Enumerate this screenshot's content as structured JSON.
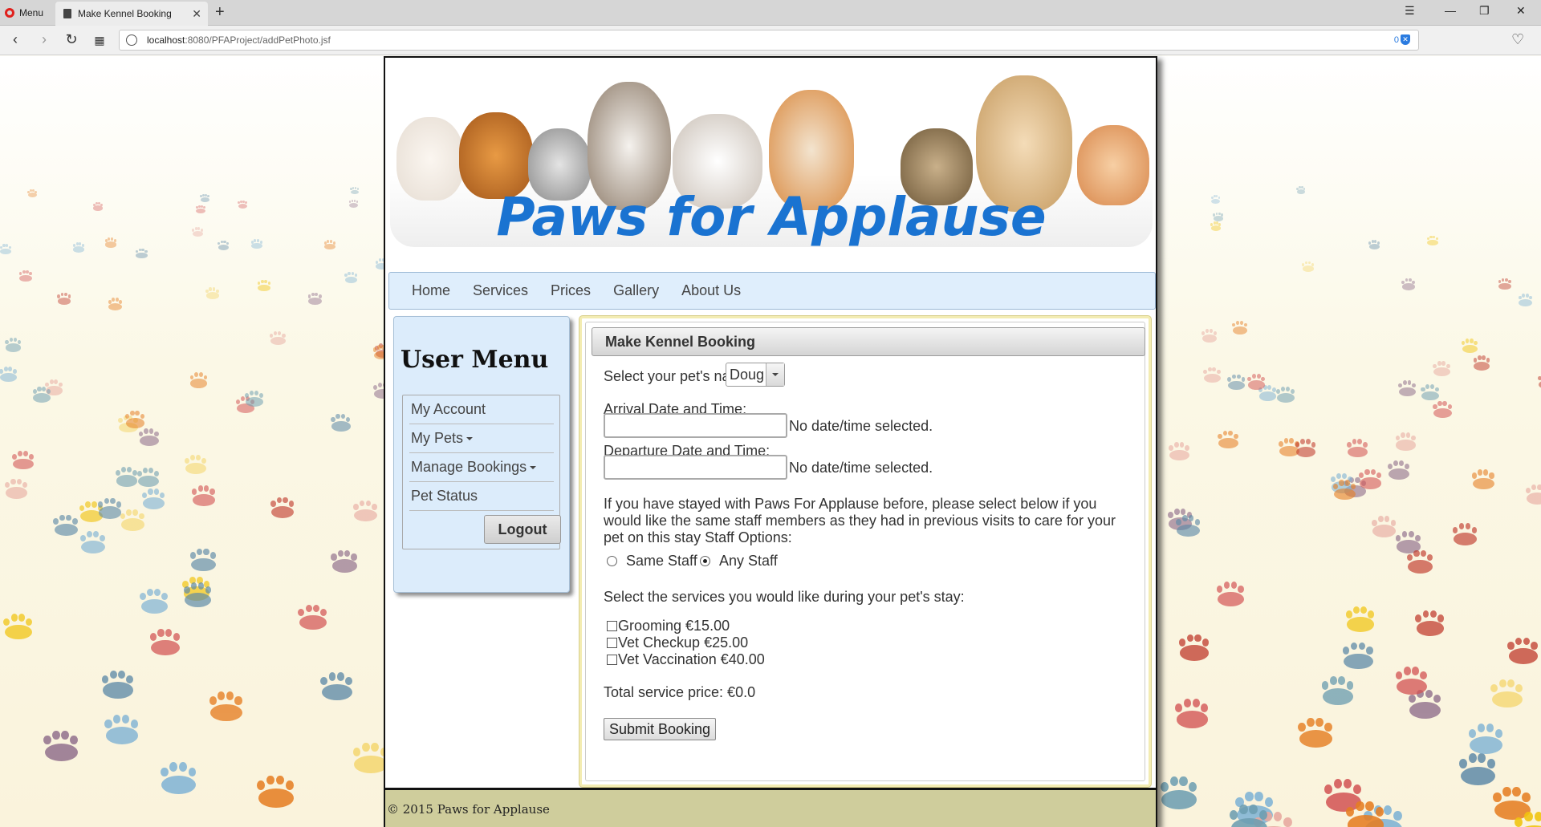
{
  "browser": {
    "menu_label": "Menu",
    "tab_title": "Make Kennel Booking",
    "url_host": "localhost",
    "url_rest": ":8080/PFAProject/addPetPhoto.jsf",
    "badge_count": "0"
  },
  "site": {
    "title": "Paws for Applause",
    "nav": [
      "Home",
      "Services",
      "Prices",
      "Gallery",
      "About Us"
    ],
    "footer": "© 2015 Paws for Applause"
  },
  "sidebar": {
    "title": "User Menu",
    "items": [
      {
        "label": "My Account",
        "has_caret": false
      },
      {
        "label": "My Pets",
        "has_caret": true
      },
      {
        "label": "Manage Bookings",
        "has_caret": true
      },
      {
        "label": "Pet Status",
        "has_caret": false
      }
    ],
    "logout_label": "Logout"
  },
  "booking": {
    "panel_title": "Make Kennel Booking",
    "pet_label": "Select your pet's name:",
    "pet_selected": "Doug",
    "arrival_label": "Arrival Date and Time:",
    "arrival_status": "No date/time selected.",
    "departure_label": "Departure Date and Time:",
    "departure_status": "No date/time selected.",
    "staff_text": "If you have stayed with Paws For Applause before, please select below if you would like the same staff members as they had in previous visits to care for your pet on this stay Staff Options:",
    "staff_options": [
      {
        "label": "Same Staff",
        "selected": false
      },
      {
        "label": "Any Staff",
        "selected": true
      }
    ],
    "services_label": "Select the services you would like during your pet's stay:",
    "services": [
      {
        "label": "Grooming €15.00",
        "checked": false
      },
      {
        "label": "Vet Checkup €25.00",
        "checked": false
      },
      {
        "label": "Vet Vaccination €40.00",
        "checked": false
      }
    ],
    "total_label": "Total service price: €0.0",
    "submit_label": "Submit Booking"
  },
  "colors": {
    "brand_blue": "#1a73d1",
    "nav_bg": "#dfeefc",
    "footer_bg": "#cfcd9c"
  }
}
